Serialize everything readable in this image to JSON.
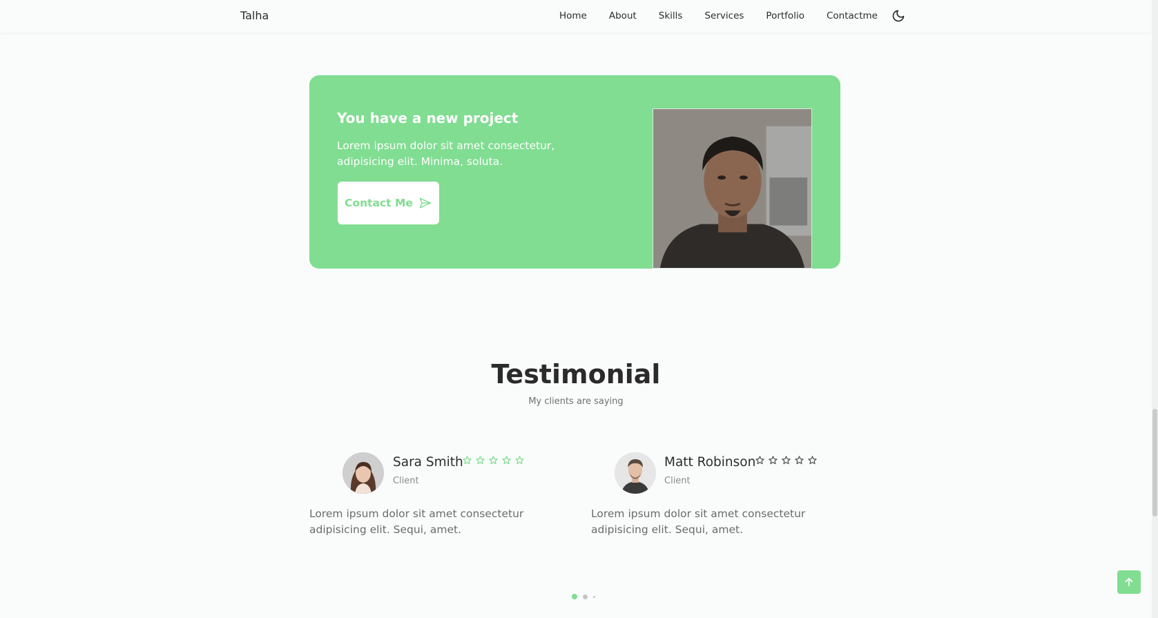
{
  "header": {
    "logo": "Talha",
    "nav": [
      "Home",
      "About",
      "Skills",
      "Services",
      "Portfolio",
      "Contactme"
    ],
    "theme_toggle_icon": "moon-icon"
  },
  "project": {
    "title": "You have a new project",
    "description": "Lorem ipsum dolor sit amet consectetur, adipisicing elit. Minima, soluta.",
    "button_label": "Contact Me",
    "button_icon": "send-icon",
    "accent_color": "#80dd91"
  },
  "testimonial": {
    "title": "Testimonial",
    "subtitle": "My clients are saying",
    "clients": [
      {
        "name": "Sara Smith",
        "role": "Client",
        "text": "Lorem ipsum dolor sit amet consectetur adipisicing elit. Sequi, amet.",
        "rating_stars": 5,
        "star_color": "#80dd91"
      },
      {
        "name": "Matt Robinson",
        "role": "Client",
        "text": "Lorem ipsum dolor sit amet consectetur adipisicing elit. Sequi, amet.",
        "rating_stars": 5,
        "star_color": "#555555"
      }
    ],
    "pagination": {
      "pages": 3,
      "active": 1
    }
  },
  "scroll_up_icon": "arrow-up-icon"
}
